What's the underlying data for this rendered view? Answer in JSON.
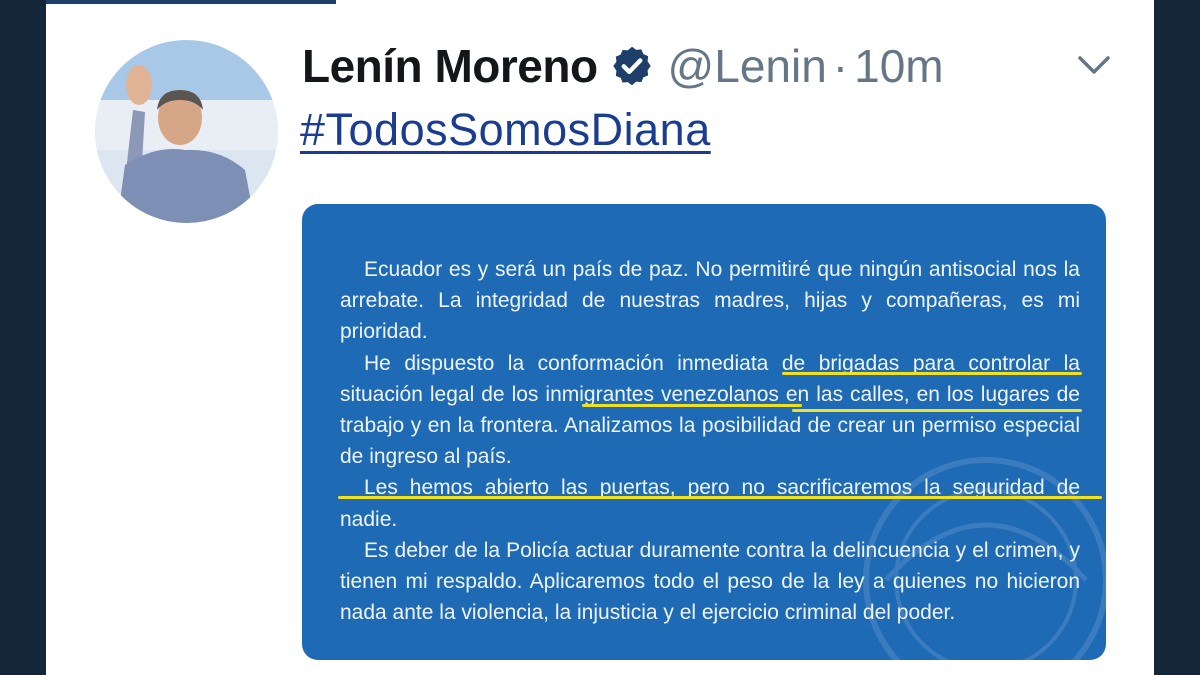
{
  "tweet": {
    "author_name": "Lenín Moreno",
    "handle": "@Lenin",
    "separator": "·",
    "timestamp": "10m",
    "hashtag": "#TodosSomosDiana"
  },
  "colors": {
    "hashtag": "#1b3d8f",
    "verified": "#1d3f6a",
    "media_bg": "#1f6ab5",
    "highlight": "#f2e01a"
  },
  "icons": {
    "verified": "verified-badge-icon",
    "menu": "chevron-down-icon"
  },
  "statement": {
    "paragraphs": [
      "Ecuador es y será un país de paz. No permitiré  que ningún antisocial nos la arrebate. La integridad de nuestras madres, hijas y compañeras, es mi prioridad.",
      "He dispuesto la conformación inmediata de brigadas para controlar la situación legal de los inmigrantes venezolanos en las calles, en los lugares de trabajo y en la frontera. Analizamos la posibilidad de crear un permiso especial de ingreso al país.",
      "Les hemos abierto las puertas, pero no sacrificaremos la seguridad de nadie.",
      "Es deber de la Policía actuar duramente contra la delincuencia y el crimen, y tienen mi respaldo. Aplicaremos todo el peso de la ley a quienes no hicieron nada ante la violencia, la injusticia y el ejercicio criminal del poder."
    ]
  }
}
